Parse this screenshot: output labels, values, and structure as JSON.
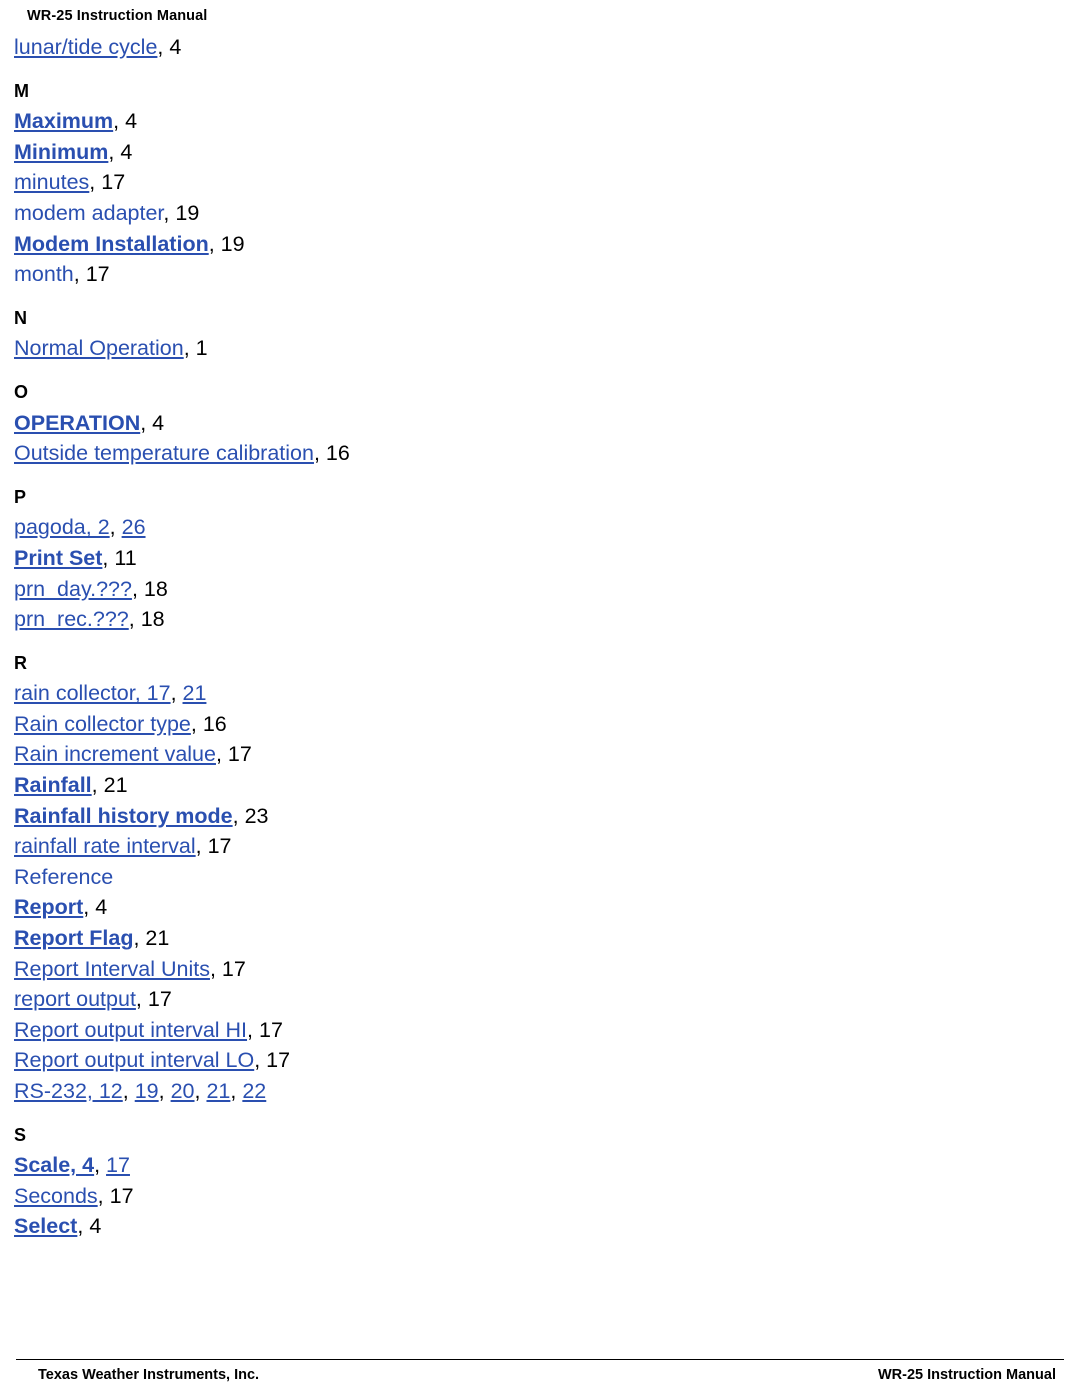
{
  "header": {
    "title": "WR-25 Instruction Manual"
  },
  "footer": {
    "left": "Texas Weather Instruments, Inc.",
    "right": "WR-25 Instruction Manual"
  },
  "index": {
    "blocks": [
      {
        "letter": "",
        "entries": [
          {
            "term": "lunar/tide cycle",
            "term_style": "plain-underline",
            "pages": [
              {
                "text": "4",
                "link": false
              }
            ]
          }
        ]
      },
      {
        "letter": "M",
        "entries": [
          {
            "term": "Maximum",
            "term_style": "bold-underline",
            "pages": [
              {
                "text": "4",
                "link": false
              }
            ]
          },
          {
            "term": "Minimum",
            "term_style": "bold-underline",
            "pages": [
              {
                "text": "4",
                "link": false
              }
            ]
          },
          {
            "term": "minutes",
            "term_style": "plain-underline",
            "pages": [
              {
                "text": "17",
                "link": false
              }
            ]
          },
          {
            "term": "modem adapter",
            "term_style": "plain",
            "pages": [
              {
                "text": "19",
                "link": false
              }
            ]
          },
          {
            "term": "Modem Installation",
            "term_style": "bold-underline",
            "pages": [
              {
                "text": "19",
                "link": false
              }
            ]
          },
          {
            "term": "month",
            "term_style": "plain",
            "pages": [
              {
                "text": "17",
                "link": false
              }
            ]
          }
        ]
      },
      {
        "letter": "N",
        "entries": [
          {
            "term": "Normal Operation",
            "term_style": "plain-underline",
            "pages": [
              {
                "text": "1",
                "link": false
              }
            ]
          }
        ]
      },
      {
        "letter": "O",
        "entries": [
          {
            "term": "OPERATION",
            "term_style": "bold-underline",
            "pages": [
              {
                "text": "4",
                "link": false
              }
            ]
          },
          {
            "term": "Outside temperature calibration",
            "term_style": "plain-underline",
            "pages": [
              {
                "text": "16",
                "link": false
              }
            ]
          }
        ]
      },
      {
        "letter": "P",
        "entries": [
          {
            "term": "pagoda, 2",
            "term_style": "plain-underline",
            "pages": [
              {
                "text": "26",
                "link": true
              }
            ]
          },
          {
            "term": "Print Set",
            "term_style": "bold-underline",
            "pages": [
              {
                "text": "11",
                "link": false
              }
            ]
          },
          {
            "term": "prn_day.???",
            "term_style": "plain-underline",
            "pages": [
              {
                "text": "18",
                "link": false
              }
            ]
          },
          {
            "term": "prn_rec.???",
            "term_style": "plain-underline",
            "pages": [
              {
                "text": "18",
                "link": false
              }
            ]
          }
        ]
      },
      {
        "letter": "R",
        "entries": [
          {
            "term": "rain collector, 17",
            "term_style": "plain-underline",
            "pages": [
              {
                "text": "21",
                "link": true
              }
            ]
          },
          {
            "term": "Rain collector type",
            "term_style": "plain-underline",
            "pages": [
              {
                "text": "16",
                "link": false
              }
            ]
          },
          {
            "term": "Rain increment value",
            "term_style": "plain-underline",
            "pages": [
              {
                "text": "17",
                "link": false
              }
            ]
          },
          {
            "term": "Rainfall",
            "term_style": "bold-underline",
            "pages": [
              {
                "text": "21",
                "link": false
              }
            ]
          },
          {
            "term": "Rainfall history mode",
            "term_style": "bold-underline",
            "pages": [
              {
                "text": "23",
                "link": false
              }
            ]
          },
          {
            "term": "rainfall rate interval",
            "term_style": "plain-underline",
            "pages": [
              {
                "text": "17",
                "link": false
              }
            ]
          },
          {
            "term": "Reference",
            "term_style": "plain",
            "pages": []
          },
          {
            "term": "Report",
            "term_style": "bold-underline",
            "pages": [
              {
                "text": "4",
                "link": false
              }
            ]
          },
          {
            "term": "Report Flag",
            "term_style": "bold-underline",
            "pages": [
              {
                "text": "21",
                "link": false
              }
            ]
          },
          {
            "term": "Report Interval Units",
            "term_style": "plain-underline",
            "pages": [
              {
                "text": "17",
                "link": false
              }
            ]
          },
          {
            "term": "report output",
            "term_style": "plain-underline",
            "pages": [
              {
                "text": "17",
                "link": false
              }
            ]
          },
          {
            "term": "Report output interval HI",
            "term_style": "plain-underline",
            "pages": [
              {
                "text": "17",
                "link": false
              }
            ]
          },
          {
            "term": "Report output interval LO",
            "term_style": "plain-underline",
            "pages": [
              {
                "text": "17",
                "link": false
              }
            ]
          },
          {
            "term": "RS-232, 12",
            "term_style": "plain-underline",
            "pages": [
              {
                "text": "19",
                "link": true
              },
              {
                "text": "20",
                "link": true
              },
              {
                "text": "21",
                "link": true
              },
              {
                "text": "22",
                "link": true
              }
            ]
          }
        ]
      },
      {
        "letter": "S",
        "entries": [
          {
            "term": "Scale, 4",
            "term_style": "bold-underline",
            "pages": [
              {
                "text": "17",
                "link": true
              }
            ]
          },
          {
            "term": "Seconds",
            "term_style": "plain-underline",
            "pages": [
              {
                "text": "17",
                "link": false
              }
            ]
          },
          {
            "term": "Select",
            "term_style": "bold-underline",
            "pages": [
              {
                "text": "4",
                "link": false
              }
            ]
          }
        ]
      }
    ]
  },
  "colors": {
    "link": "#2a4fb0",
    "text": "#000000",
    "background": "#ffffff"
  }
}
